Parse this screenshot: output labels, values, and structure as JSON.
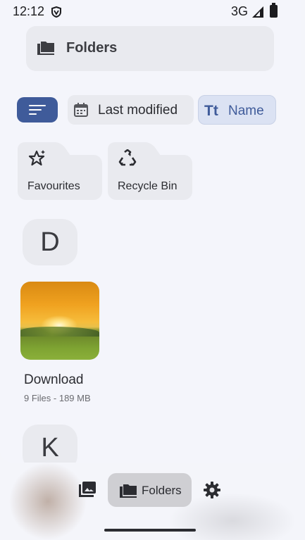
{
  "status_bar": {
    "time": "12:12",
    "network": "3G"
  },
  "header": {
    "title": "Folders"
  },
  "sort_bar": {
    "modified_label": "Last modified",
    "name_label": "Name",
    "name_icon_text": "Tt"
  },
  "special_folders": [
    {
      "label": "Favourites",
      "icon": "star-sparkle-icon"
    },
    {
      "label": "Recycle Bin",
      "icon": "recycle-icon"
    }
  ],
  "sections": [
    {
      "letter": "D",
      "folders": [
        {
          "name": "Download",
          "meta": "9 Files - 189 MB"
        }
      ]
    },
    {
      "letter": "K",
      "folders": []
    }
  ],
  "bottom_nav": {
    "items": [
      {
        "name": "photos",
        "icon": "photo-icon"
      },
      {
        "name": "folders",
        "icon": "folder-icon",
        "label": "Folders",
        "selected": true
      },
      {
        "name": "settings",
        "icon": "gear-icon"
      }
    ]
  },
  "colors": {
    "accent": "#3f5b9a",
    "surface": "#f4f5fb",
    "chip": "#e9eaef"
  }
}
